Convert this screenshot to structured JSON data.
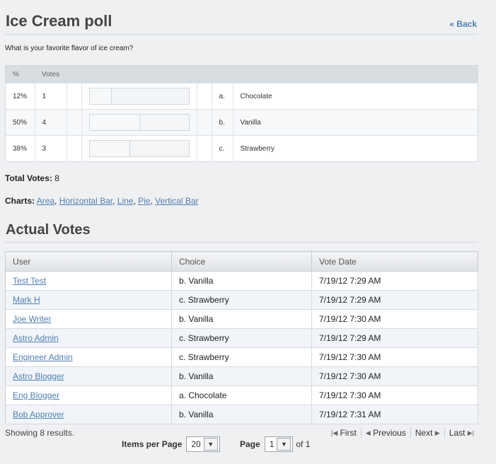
{
  "header": {
    "title": "Ice Cream poll",
    "back_label": "« Back"
  },
  "question": "What is your favorite flavor of ice cream?",
  "poll": {
    "col_percent": "%",
    "col_votes": "Votes",
    "rows": [
      {
        "percent": "12%",
        "votes": "1",
        "share": 0.22,
        "letter": "a.",
        "choice": "Chocolate"
      },
      {
        "percent": "50%",
        "votes": "4",
        "share": 0.5,
        "letter": "b.",
        "choice": "Vanilla"
      },
      {
        "percent": "38%",
        "votes": "3",
        "share": 0.4,
        "letter": "c.",
        "choice": "Strawberry"
      }
    ]
  },
  "totals": {
    "label": "Total Votes:",
    "value": "8"
  },
  "charts": {
    "label": "Charts:",
    "links": [
      "Area",
      "Horizontal Bar",
      "Line",
      "Pie",
      "Vertical Bar"
    ]
  },
  "votes": {
    "title": "Actual Votes",
    "columns": [
      "User",
      "Choice",
      "Vote Date"
    ],
    "rows": [
      {
        "user": "Test Test",
        "choice": "b. Vanilla",
        "date": "7/19/12 7:29 AM"
      },
      {
        "user": "Mark H",
        "choice": "c. Strawberry",
        "date": "7/19/12 7:29 AM"
      },
      {
        "user": "Joe Writer",
        "choice": "b. Vanilla",
        "date": "7/19/12 7:30 AM"
      },
      {
        "user": "Astro Admin",
        "choice": "c. Strawberry",
        "date": "7/19/12 7:29 AM"
      },
      {
        "user": "Engineer Admin",
        "choice": "c. Strawberry",
        "date": "7/19/12 7:30 AM"
      },
      {
        "user": "Astro Blogger",
        "choice": "b. Vanilla",
        "date": "7/19/12 7:30 AM"
      },
      {
        "user": "Eng Blogger",
        "choice": "a. Chocolate",
        "date": "7/19/12 7:30 AM"
      },
      {
        "user": "Bob Approver",
        "choice": "b. Vanilla",
        "date": "7/19/12 7:31 AM"
      }
    ]
  },
  "footer": {
    "showing": "Showing 8 results.",
    "first": "First",
    "previous": "Previous",
    "next": "Next",
    "last": "Last",
    "items_per_page_label": "Items per Page",
    "items_per_page_value": "20",
    "page_label": "Page",
    "page_value": "1",
    "of_label": "of 1"
  }
}
